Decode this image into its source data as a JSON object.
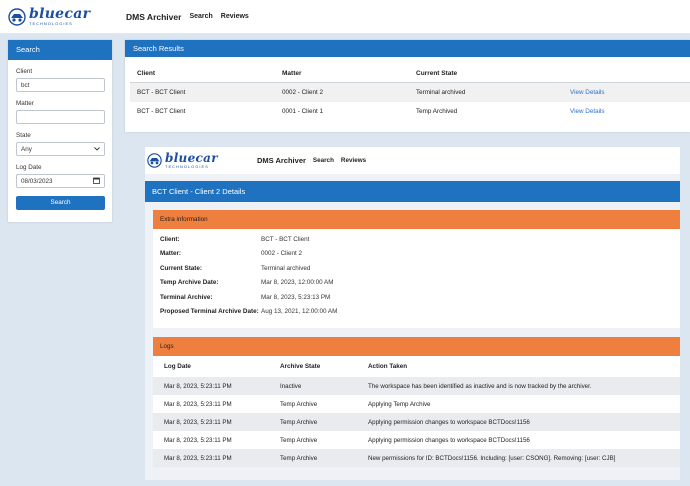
{
  "brand": {
    "name": "bluecar",
    "tagline": "TECHNOLOGIES",
    "logo_icon": "car-logo-icon",
    "accent": "#1f72bf",
    "orange": "#ef7f3f"
  },
  "nav": {
    "app_title": "DMS Archiver",
    "search": "Search",
    "reviews": "Reviews"
  },
  "search_panel": {
    "title": "Search",
    "client_label": "Client",
    "client_value": "bct",
    "matter_label": "Matter",
    "matter_value": "",
    "state_label": "State",
    "state_value": "Any",
    "log_date_label": "Log Date",
    "log_date_value": "08/03/2023",
    "button": "Search"
  },
  "results": {
    "title": "Search Results",
    "columns": [
      "Client",
      "Matter",
      "Current State",
      ""
    ],
    "rows": [
      {
        "client": "BCT - BCT Client",
        "matter": "0002 - Client 2",
        "state": "Terminal archived",
        "link": "View Details"
      },
      {
        "client": "BCT - BCT Client",
        "matter": "0001 - Client 1",
        "state": "Temp Archived",
        "link": "View Details"
      }
    ]
  },
  "details": {
    "nav_title": "DMS Archiver",
    "nav_search": "Search",
    "nav_reviews": "Reviews",
    "title": "BCT Client - Client 2 Details",
    "extra_title": "Extra information",
    "info": [
      {
        "key": "Client:",
        "value": "BCT - BCT Client"
      },
      {
        "key": "Matter:",
        "value": "0002 - Client 2"
      },
      {
        "key": "Current State:",
        "value": "Terminal archived"
      },
      {
        "key": "Temp Archive Date:",
        "value": "Mar 8, 2023, 12:00:00 AM"
      },
      {
        "key": "Terminal Archive:",
        "value": "Mar 8, 2023, 5:23:13 PM"
      },
      {
        "key": "Proposed Terminal Archive Date:",
        "value": "Aug 13, 2021, 12:00:00 AM"
      }
    ],
    "logs_title": "Logs",
    "log_columns": [
      "Log Date",
      "Archive State",
      "Action Taken"
    ],
    "logs": [
      {
        "date": "Mar 8, 2023, 5:23:11 PM",
        "state": "Inactive",
        "action": "The workspace has been identified as inactive and is now tracked by the archiver."
      },
      {
        "date": "Mar 8, 2023, 5:23:11 PM",
        "state": "Temp Archive",
        "action": "Applying Temp Archive"
      },
      {
        "date": "Mar 8, 2023, 5:23:11 PM",
        "state": "Temp Archive",
        "action": "Applying permission changes to workspace BCTDocs!1156"
      },
      {
        "date": "Mar 8, 2023, 5:23:11 PM",
        "state": "Temp Archive",
        "action": "Applying permission changes to workspace BCTDocs!1156"
      },
      {
        "date": "Mar 8, 2023, 5:23:11 PM",
        "state": "Temp Archive",
        "action": "New permissions for ID: BCTDocs!1156. Including: [user: CSONG]. Removing: [user: CJB]"
      }
    ]
  }
}
